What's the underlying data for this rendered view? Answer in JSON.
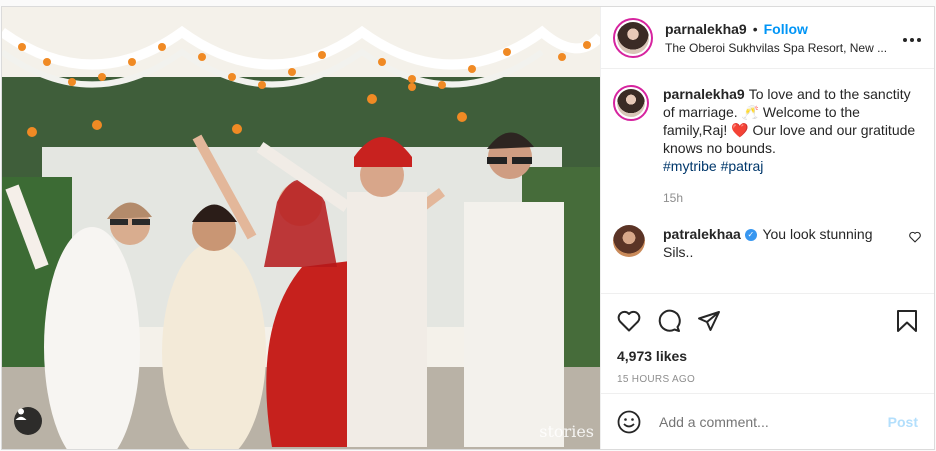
{
  "header": {
    "username": "parnalekha9",
    "follow_label": "Follow",
    "dot": "•",
    "location": "The Oberoi Sukhvilas Spa Resort, New ...",
    "more_icon": "more-horizontal-icon"
  },
  "caption": {
    "username": "parnalekha9",
    "text_1": "To love and to the sanctity of marriage. ",
    "emoji_1": "🥂",
    "text_2": " Welcome to the family,Raj! ",
    "emoji_2": "❤️",
    "text_3": " Our love and our gratitude knows no bounds.",
    "hashtag_1": "#mytribe",
    "hashtag_2": "#patraj",
    "time": "15h"
  },
  "comment": {
    "username": "patralekhaa",
    "verified_icon": "verified-badge-icon",
    "text": "You look stunning Sils.."
  },
  "actions": {
    "icons": [
      "heart-icon",
      "comment-icon",
      "share-icon",
      "bookmark-icon"
    ],
    "likes": "4,973 likes",
    "ago": "15 HOURS AGO"
  },
  "add_comment": {
    "placeholder": "Add a comment...",
    "post_label": "Post"
  },
  "photo": {
    "watermark": "stories"
  },
  "colors": {
    "accent_blue": "#0095f6",
    "post_disabled": "#b3dffc",
    "heart_red": "#ed4956",
    "text": "#262626",
    "muted": "#8e8e8e"
  }
}
